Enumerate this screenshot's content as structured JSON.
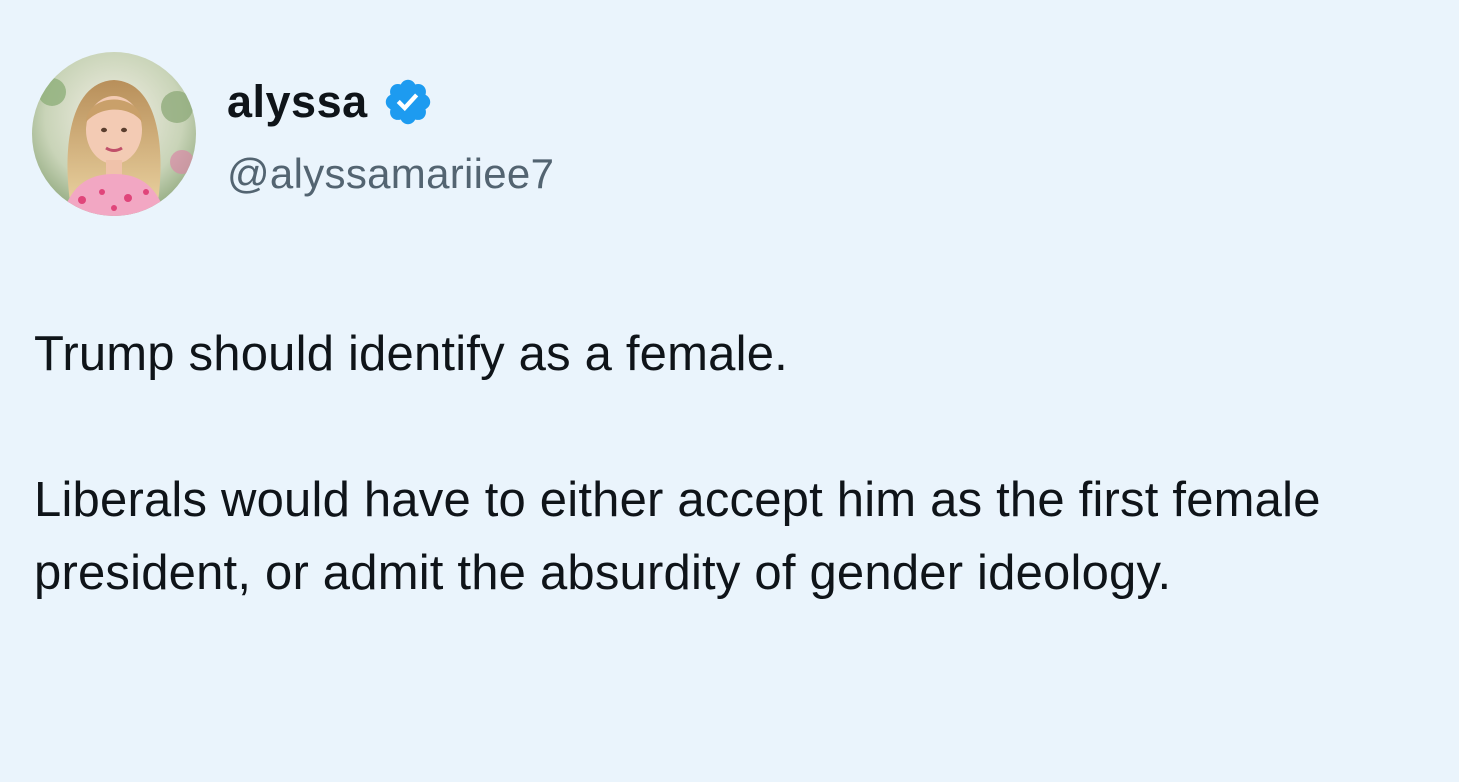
{
  "tweet": {
    "author": {
      "display_name": "alyssa",
      "handle": "@alyssamariiee7",
      "verified": true,
      "verified_icon": "verified-badge-icon",
      "avatar_icon": "avatar-photo"
    },
    "paragraphs": [
      "Trump should identify as a female.",
      "Liberals would have to either accept him as the first female president, or admit the absurdity of gender ideology."
    ]
  },
  "colors": {
    "background": "#eaf4fc",
    "text": "#0f1419",
    "handle": "#536471",
    "verified": "#1d9bf0"
  }
}
